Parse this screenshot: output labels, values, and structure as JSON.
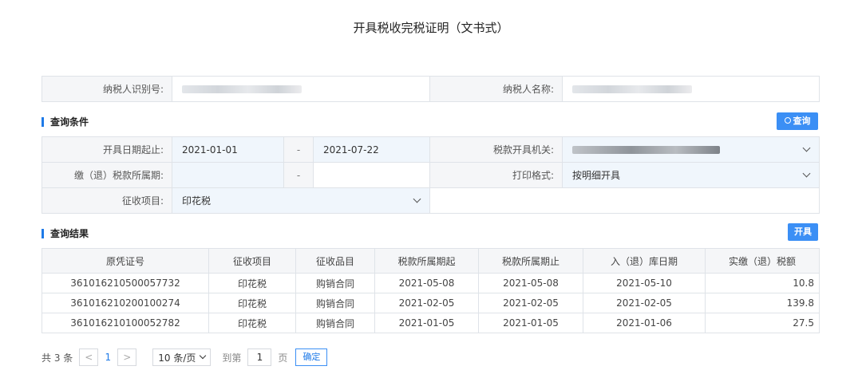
{
  "page_title": "开具税收完税证明（文书式）",
  "taxpayer": {
    "id_label": "纳税人识别号:",
    "name_label": "纳税人名称:"
  },
  "query": {
    "section_title": "查询条件",
    "search_button": "查询",
    "date_range_label": "开具日期起止:",
    "date_start": "2021-01-01",
    "date_separator": "-",
    "date_end": "2021-07-22",
    "authority_label": "税款开具机关:",
    "period_label": "缴（退）税款所属期:",
    "period_separator": "-",
    "print_format_label": "打印格式:",
    "print_format_value": "按明细开具",
    "levy_item_label": "征收项目:",
    "levy_item_value": "印花税"
  },
  "results": {
    "section_title": "查询结果",
    "issue_button": "开具",
    "columns": [
      "原凭证号",
      "征收项目",
      "征收品目",
      "税款所属期起",
      "税款所属期止",
      "入（退）库日期",
      "实缴（退）税额"
    ],
    "rows": [
      [
        "361016210500057732",
        "印花税",
        "购销合同",
        "2021-05-08",
        "2021-05-08",
        "2021-05-10",
        "10.8"
      ],
      [
        "361016210200100274",
        "印花税",
        "购销合同",
        "2021-02-05",
        "2021-02-05",
        "2021-02-05",
        "139.8"
      ],
      [
        "361016210100052782",
        "印花税",
        "购销合同",
        "2021-01-05",
        "2021-01-05",
        "2021-01-06",
        "27.5"
      ]
    ]
  },
  "pager": {
    "total": "共 3 条",
    "prev": "<",
    "current_page": "1",
    "next": ">",
    "page_size": "10 条/页",
    "goto_label": "到第",
    "goto_value": "1",
    "page_unit": "页",
    "confirm": "确定"
  },
  "colors": {
    "accent": "#3b8ff5",
    "link": "#1e7ae8",
    "label_bg": "#f5f6f8",
    "input_bg": "#f0f6fc"
  },
  "icons": {
    "search": "search-icon",
    "dropdown": "chevron-down-icon"
  }
}
